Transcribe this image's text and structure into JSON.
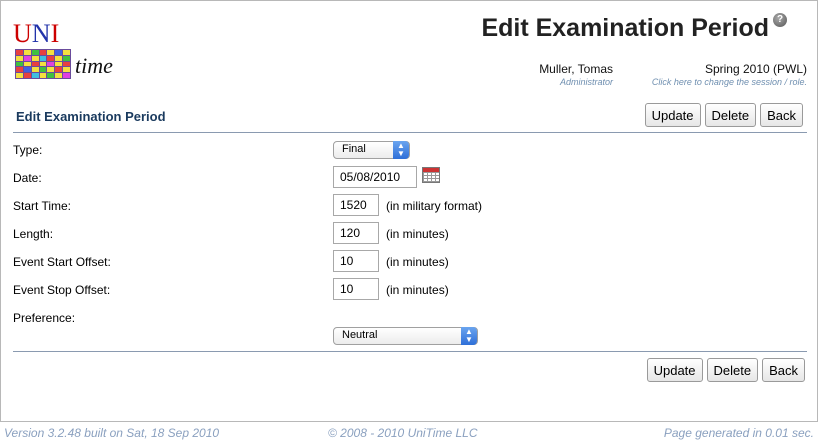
{
  "colors": {
    "accent": "#1a3a5e",
    "hint": "#6f8fb0",
    "footer": "#8aa0bf"
  },
  "logo": {
    "u": "U",
    "n": "N",
    "i": "I",
    "time": "time"
  },
  "header": {
    "title": "Edit Examination Period",
    "help_icon": "help-icon",
    "user_name": "Muller, Tomas",
    "user_role": "Administrator",
    "session_name": "Spring 2010 (PWL)",
    "session_hint": "Click here to change the session / role."
  },
  "section": {
    "title": "Edit Examination Period"
  },
  "buttons": {
    "update": "Update",
    "delete": "Delete",
    "back": "Back"
  },
  "form": {
    "type": {
      "label": "Type:",
      "value": "Final"
    },
    "date": {
      "label": "Date:",
      "value": "05/08/2010"
    },
    "start_time": {
      "label": "Start Time:",
      "value": "1520",
      "hint": "(in military format)"
    },
    "length": {
      "label": "Length:",
      "value": "120",
      "hint": "(in minutes)"
    },
    "event_start_offset": {
      "label": "Event Start Offset:",
      "value": "10",
      "hint": "(in minutes)"
    },
    "event_stop_offset": {
      "label": "Event Stop Offset:",
      "value": "10",
      "hint": "(in minutes)"
    },
    "preference": {
      "label": "Preference:",
      "value": "Neutral"
    }
  },
  "footer": {
    "version": "Version 3.2.48 built on Sat, 18 Sep 2010",
    "copyright": "© 2008 - 2010 UniTime LLC",
    "generated": "Page generated in 0.01 sec."
  }
}
